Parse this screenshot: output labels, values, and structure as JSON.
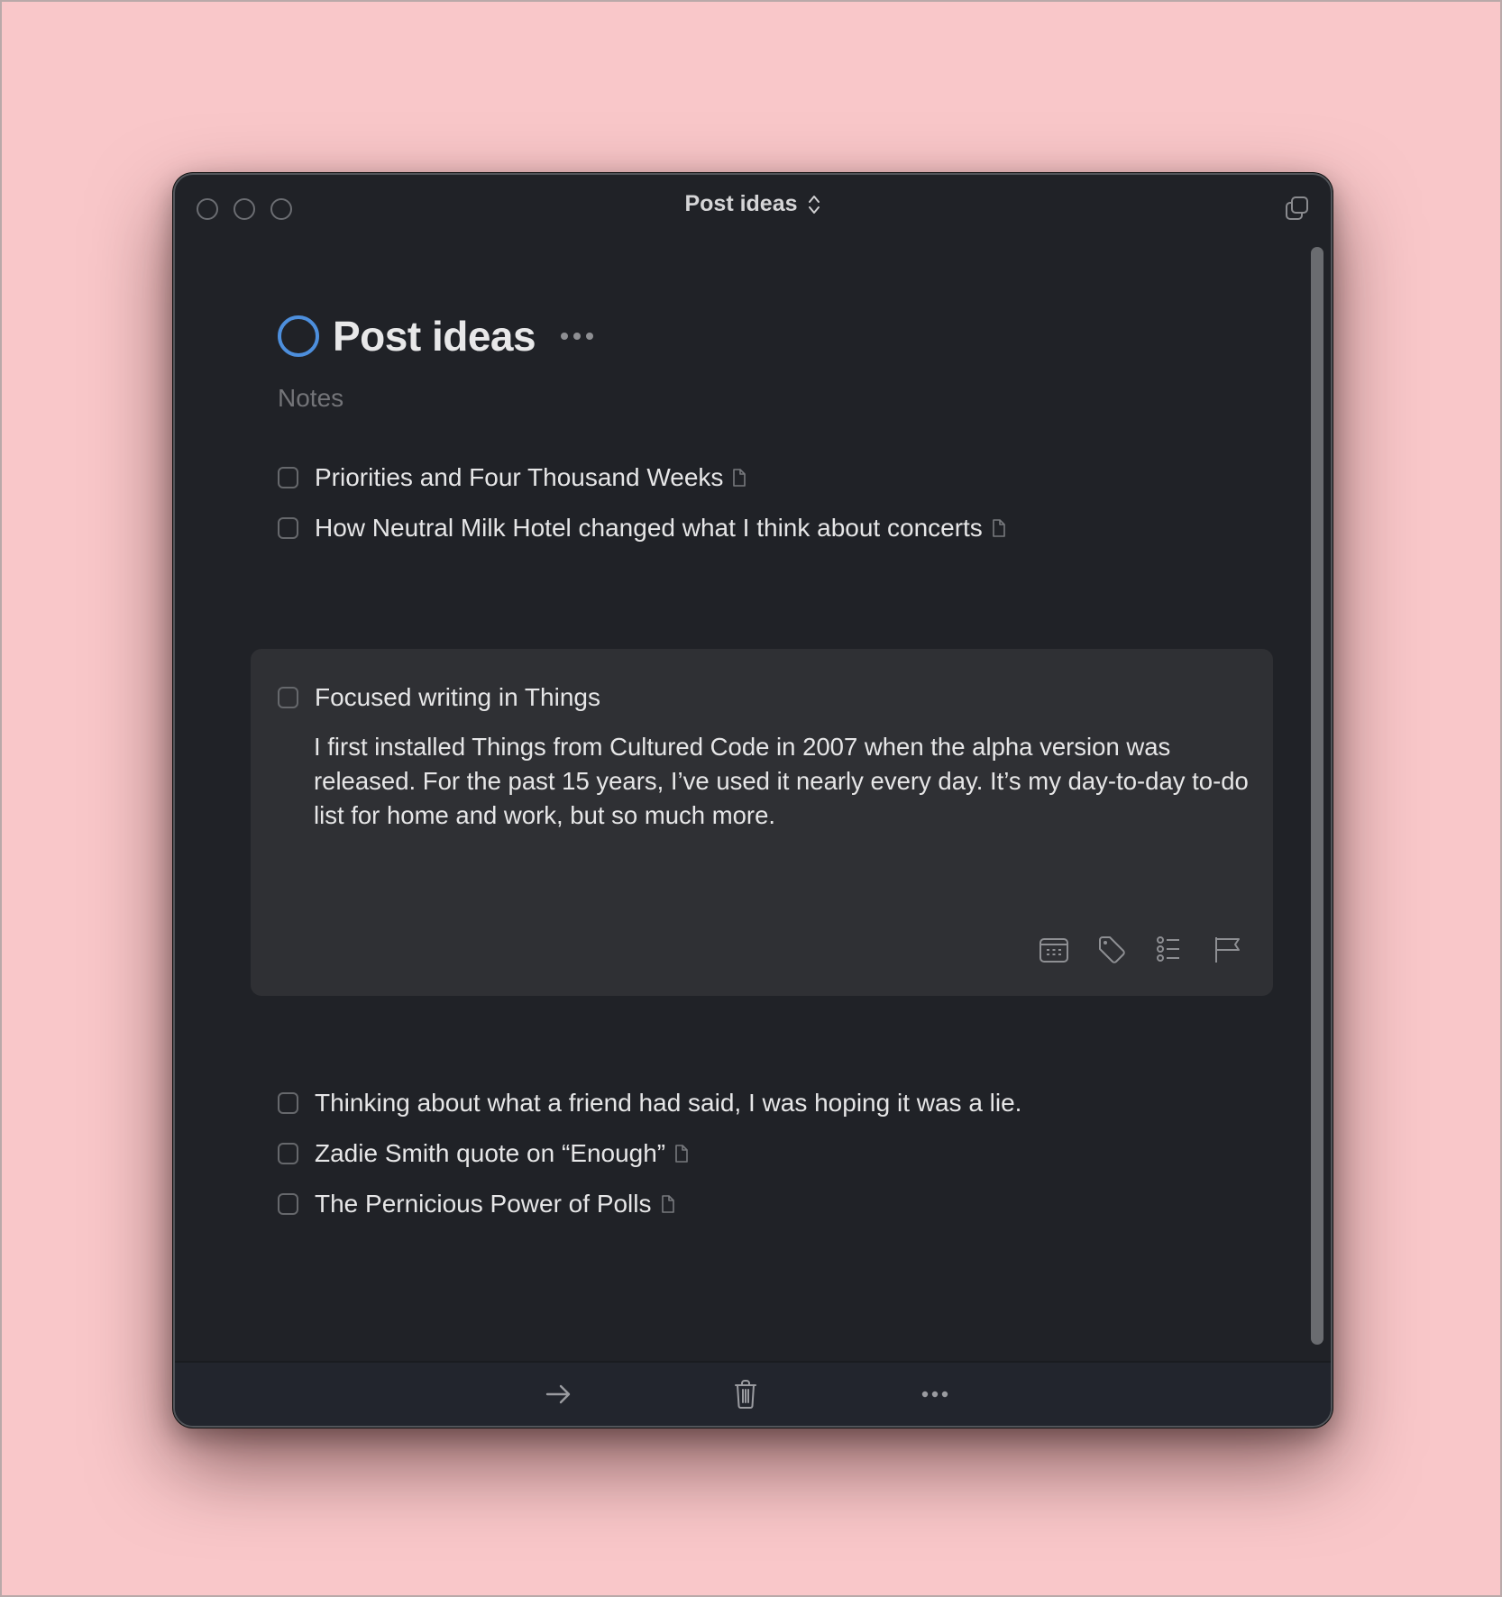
{
  "window": {
    "title": "Post ideas",
    "title_icon": "chevron-up-down-icon",
    "right_icon": "duplicate-window-icon"
  },
  "project": {
    "title": "Post ideas",
    "status_icon": "project-progress-ring-icon",
    "progress": 0,
    "accent_color": "#4d8fdd",
    "notes_placeholder": "Notes",
    "more_icon": "ellipsis-icon"
  },
  "tasks_top": [
    {
      "title": "Priorities and Four Thousand Weeks",
      "has_note": true,
      "completed": false
    },
    {
      "title": "How Neutral Milk Hotel changed what I think about concerts",
      "has_note": true,
      "completed": false
    }
  ],
  "open_task": {
    "title": "Focused writing in Things",
    "completed": false,
    "notes": "I first installed Things from Cultured Code in 2007 when the alpha version was released. For the past 15 years, I’ve used it nearly every day. It’s my day-to-day to-do list for home and work, but so much more.",
    "tools": [
      "calendar-icon",
      "tag-icon",
      "checklist-icon",
      "flag-icon"
    ]
  },
  "tasks_bottom": [
    {
      "title": "Thinking about what a friend had said, I was hoping it was a lie.",
      "has_note": false,
      "completed": false
    },
    {
      "title": "Zadie Smith quote on “Enough”",
      "has_note": true,
      "completed": false
    },
    {
      "title": "The Pernicious Power of Polls",
      "has_note": true,
      "completed": false
    }
  ],
  "bottom_toolbar": [
    "move-arrow-icon",
    "trash-icon",
    "more-ellipsis-icon"
  ],
  "colors": {
    "background": "#f9c7c9",
    "window": "#202227",
    "card": "#2f3034",
    "text": "#e6e6e7",
    "muted": "#737478"
  }
}
